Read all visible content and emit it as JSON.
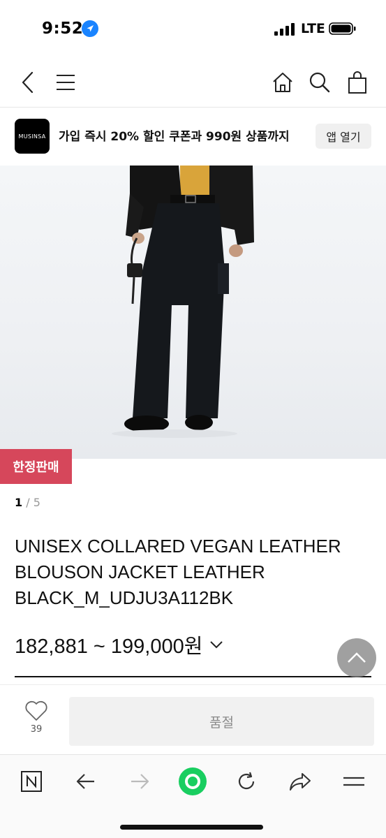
{
  "status_bar": {
    "time": "9:52",
    "network": "LTE",
    "icons": [
      "location-arrow-icon",
      "signal-icon",
      "battery-icon"
    ]
  },
  "nav": {
    "icons": [
      "back-icon",
      "menu-icon",
      "home-icon",
      "search-icon",
      "cart-icon"
    ]
  },
  "app_banner": {
    "logo_text": "MUSINSA",
    "message": "가입 즉시 20% 할인 쿠폰과 990원 상품까지",
    "open_app_label": "앱 열기"
  },
  "product": {
    "badge": "한정판매",
    "image_index": "1",
    "image_separator": "/",
    "image_total": "5",
    "title_lines": [
      "UNISEX COLLARED VEGAN LEATHER",
      "BLOUSON JACKET LEATHER",
      "BLACK_M_UDJU3A112BK"
    ],
    "price_range": "182,881 ~ 199,000원"
  },
  "purchase_bar": {
    "like_count": "39",
    "button_label": "품절"
  },
  "browser_toolbar": {
    "icons": [
      "naver-n-icon",
      "back-arrow-icon",
      "forward-arrow-icon",
      "green-dot-icon",
      "reload-icon",
      "share-icon",
      "hamburger-icon"
    ]
  },
  "colors": {
    "badge": "#d6475b",
    "accent_green": "#19ce60",
    "soldout_bg": "#f1f1f1"
  }
}
